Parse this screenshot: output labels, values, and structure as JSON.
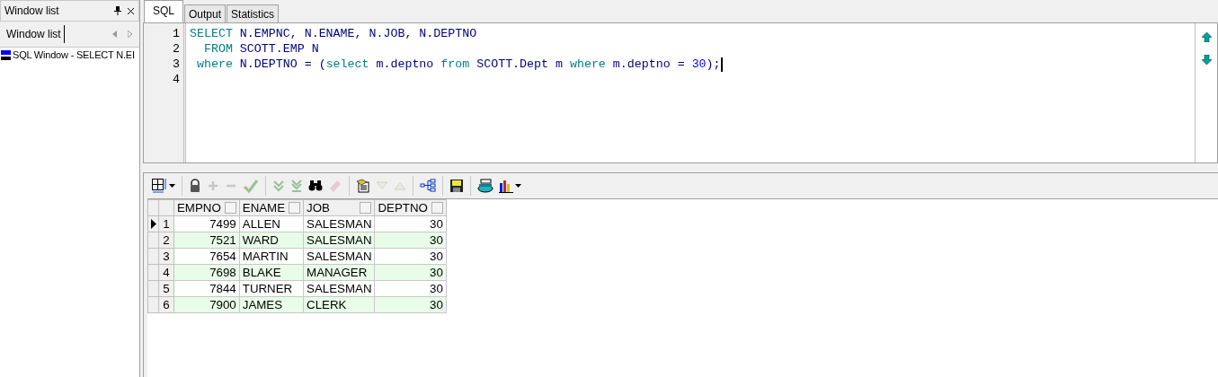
{
  "window_list": {
    "title": "Window list",
    "tab": "Window list",
    "items": [
      {
        "label": "SQL Window - SELECT N.EI",
        "selected": false
      }
    ]
  },
  "tabs": [
    {
      "label": "SQL",
      "selected": true
    },
    {
      "label": "Output",
      "selected": false
    },
    {
      "label": "Statistics",
      "selected": false
    }
  ],
  "editor": {
    "lines": [
      {
        "number": "1",
        "tokens": [
          {
            "kind": "keyword",
            "text": "SELECT"
          },
          {
            "kind": "ident",
            "text": " N.EMPNC, N.ENAME, N.JOB, N.DEPTNO"
          }
        ]
      },
      {
        "number": "2",
        "tokens": [
          {
            "kind": "keyword",
            "text": "  FROM"
          },
          {
            "kind": "ident",
            "text": " SCOTT.EMP N"
          }
        ]
      },
      {
        "number": "3",
        "tokens": [
          {
            "kind": "keyword",
            "text": " where"
          },
          {
            "kind": "ident",
            "text": " N.DEPTNO = ("
          },
          {
            "kind": "keyword",
            "text": "select"
          },
          {
            "kind": "ident",
            "text": " m.deptno "
          },
          {
            "kind": "keyword",
            "text": "from"
          },
          {
            "kind": "ident",
            "text": " SCOTT.Dept m "
          },
          {
            "kind": "keyword",
            "text": "where"
          },
          {
            "kind": "ident",
            "text": " m.deptno = "
          },
          {
            "kind": "number",
            "text": "30"
          },
          {
            "kind": "ident",
            "text": ");"
          }
        ],
        "cursor": true
      },
      {
        "number": "4"
      }
    ]
  },
  "toolbar": {
    "groups": [
      [
        {
          "kind": "grid",
          "disabled": false,
          "dropdown": true
        }
      ],
      [
        {
          "kind": "lock",
          "disabled": false
        },
        {
          "kind": "plus",
          "disabled": true
        },
        {
          "kind": "minus",
          "disabled": true
        },
        {
          "kind": "check",
          "disabled": true
        }
      ],
      [
        {
          "kind": "next",
          "disabled": true
        },
        {
          "kind": "last",
          "disabled": true
        },
        {
          "kind": "find",
          "disabled": false
        },
        {
          "kind": "eraser",
          "disabled": true
        }
      ],
      [
        {
          "kind": "query",
          "disabled": false
        },
        {
          "kind": "down",
          "disabled": true
        },
        {
          "kind": "up",
          "disabled": true
        }
      ],
      [
        {
          "kind": "tree",
          "disabled": false
        }
      ],
      [
        {
          "kind": "save",
          "disabled": false
        }
      ],
      [
        {
          "kind": "print",
          "disabled": false
        },
        {
          "kind": "chart",
          "disabled": false,
          "dropdown": true
        }
      ]
    ]
  },
  "grid": {
    "columns": [
      "EMPNO",
      "ENAME",
      "JOB",
      "DEPTNO"
    ],
    "rows": [
      {
        "number": "1",
        "current": true,
        "cells": [
          "7499",
          "ALLEN",
          "SALESMAN",
          "30"
        ]
      },
      {
        "number": "2",
        "current": false,
        "cells": [
          "7521",
          "WARD",
          "SALESMAN",
          "30"
        ]
      },
      {
        "number": "3",
        "current": false,
        "cells": [
          "7654",
          "MARTIN",
          "SALESMAN",
          "30"
        ]
      },
      {
        "number": "4",
        "current": false,
        "cells": [
          "7698",
          "BLAKE",
          "MANAGER",
          "30"
        ]
      },
      {
        "number": "5",
        "current": false,
        "cells": [
          "7844",
          "TURNER",
          "SALESMAN",
          "30"
        ]
      },
      {
        "number": "6",
        "current": false,
        "cells": [
          "7900",
          "JAMES",
          "CLERK",
          "30"
        ]
      }
    ]
  }
}
